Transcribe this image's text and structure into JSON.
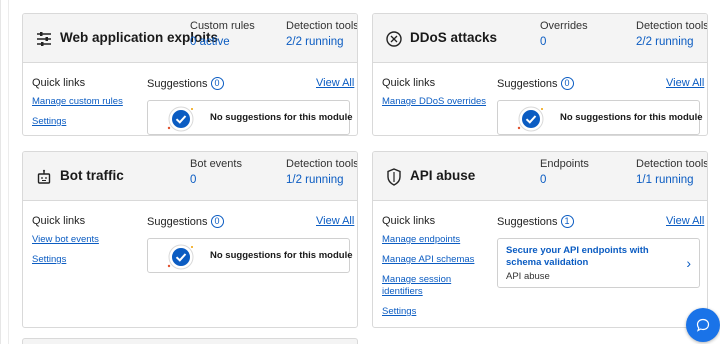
{
  "colors": {
    "link": "#0b5cc2",
    "header_bg": "#f4f4f4",
    "check_circle": "#0b5cc2",
    "fab": "#1a73e8"
  },
  "cards": {
    "waf": {
      "title": "Web application exploits",
      "icon": "sliders-icon",
      "metric1": {
        "label": "Custom rules",
        "value": "0 active"
      },
      "metric2": {
        "label": "Detection tools",
        "value": "2/2 running"
      },
      "quick_links_label": "Quick links",
      "links": [
        "Manage custom rules",
        "Settings"
      ],
      "suggestions_label": "Suggestions",
      "suggestions_count": "0",
      "view_all": "View All",
      "empty_text": "No suggestions for this module"
    },
    "ddos": {
      "title": "DDoS attacks",
      "icon": "ddos-shield-icon",
      "metric1": {
        "label": "Overrides",
        "value": "0"
      },
      "metric2": {
        "label": "Detection tools",
        "value": "2/2 running"
      },
      "quick_links_label": "Quick links",
      "links": [
        "Manage DDoS overrides"
      ],
      "suggestions_label": "Suggestions",
      "suggestions_count": "0",
      "view_all": "View All",
      "empty_text": "No suggestions for this module"
    },
    "bot": {
      "title": "Bot traffic",
      "icon": "robot-icon",
      "metric1": {
        "label": "Bot events",
        "value": "0"
      },
      "metric2": {
        "label": "Detection tools",
        "value": "1/2 running"
      },
      "quick_links_label": "Quick links",
      "links": [
        "View bot events",
        "Settings"
      ],
      "suggestions_label": "Suggestions",
      "suggestions_count": "0",
      "view_all": "View All",
      "empty_text": "No suggestions for this module"
    },
    "api": {
      "title": "API abuse",
      "icon": "api-shield-icon",
      "metric1": {
        "label": "Endpoints",
        "value": "0"
      },
      "metric2": {
        "label": "Detection tools",
        "value": "1/1 running"
      },
      "quick_links_label": "Quick links",
      "links": [
        "Manage endpoints",
        "Manage API schemas",
        "Manage session",
        "identifiers",
        "Settings"
      ],
      "suggestions_label": "Suggestions",
      "suggestions_count": "1",
      "view_all": "View All",
      "suggestion": {
        "title": "Secure your API endpoints with schema validation",
        "subtitle": "API abuse"
      }
    }
  }
}
